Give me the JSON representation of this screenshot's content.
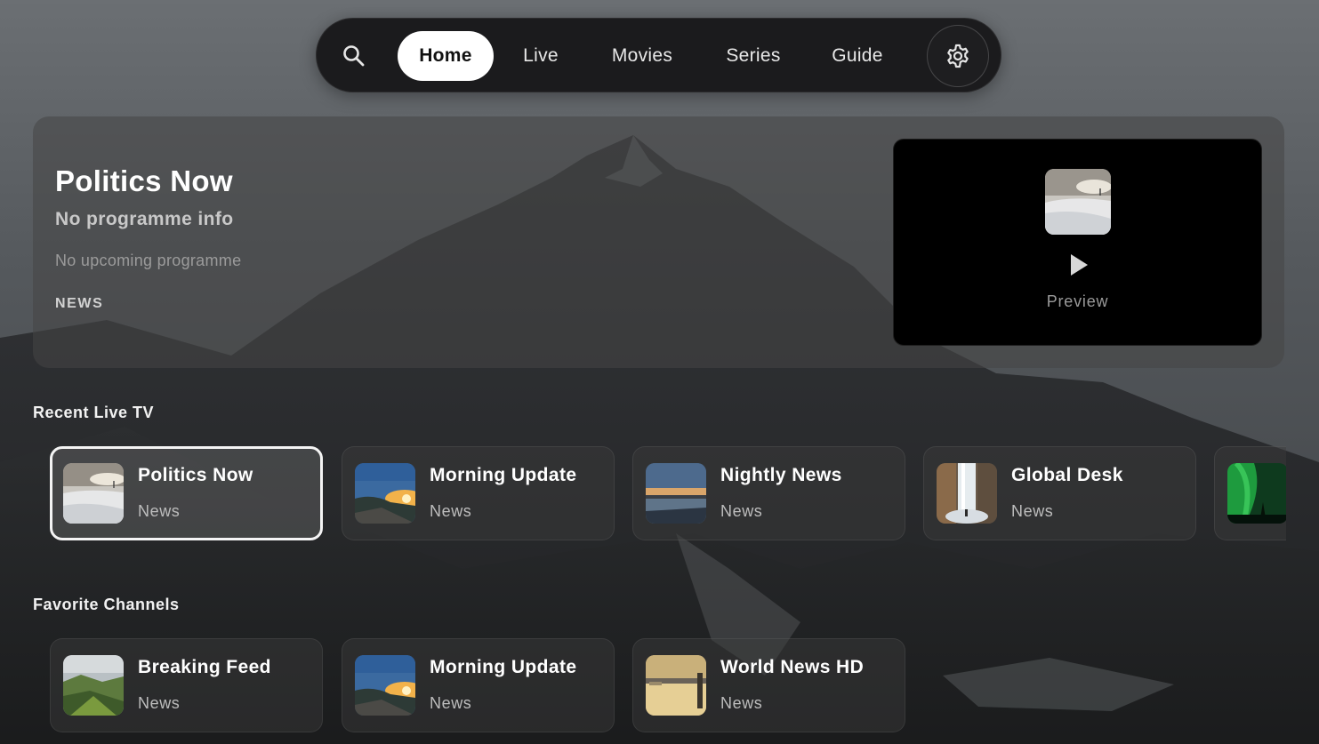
{
  "nav": {
    "tabs": [
      {
        "label": "Home",
        "active": true
      },
      {
        "label": "Live",
        "active": false
      },
      {
        "label": "Movies",
        "active": false
      },
      {
        "label": "Series",
        "active": false
      },
      {
        "label": "Guide",
        "active": false
      }
    ],
    "search_icon": "search-icon",
    "settings_icon": "gear-icon"
  },
  "hero": {
    "title": "Politics Now",
    "subtitle": "No programme info",
    "next": "No upcoming programme",
    "genre": "NEWS",
    "preview_label": "Preview",
    "preview_icon": "play-icon"
  },
  "recent": {
    "title": "Recent Live TV",
    "items": [
      {
        "name": "Politics Now",
        "genre": "News",
        "thumb": "snowy-hill"
      },
      {
        "name": "Morning Update",
        "genre": "News",
        "thumb": "sunset-road"
      },
      {
        "name": "Nightly News",
        "genre": "News",
        "thumb": "dusk-sea"
      },
      {
        "name": "Global Desk",
        "genre": "News",
        "thumb": "waterfall"
      },
      {
        "name": "",
        "genre": "",
        "thumb": "aurora"
      }
    ]
  },
  "favorites": {
    "title": "Favorite Channels",
    "items": [
      {
        "name": "Breaking Feed",
        "genre": "News",
        "thumb": "green-valley"
      },
      {
        "name": "Morning Update",
        "genre": "News",
        "thumb": "sunset-road"
      },
      {
        "name": "World News HD",
        "genre": "News",
        "thumb": "golden-harbor"
      }
    ]
  },
  "colors": {
    "accent": "#ffffff",
    "nav_bg": "#1b1b1d",
    "preview_bg": "#000000"
  }
}
